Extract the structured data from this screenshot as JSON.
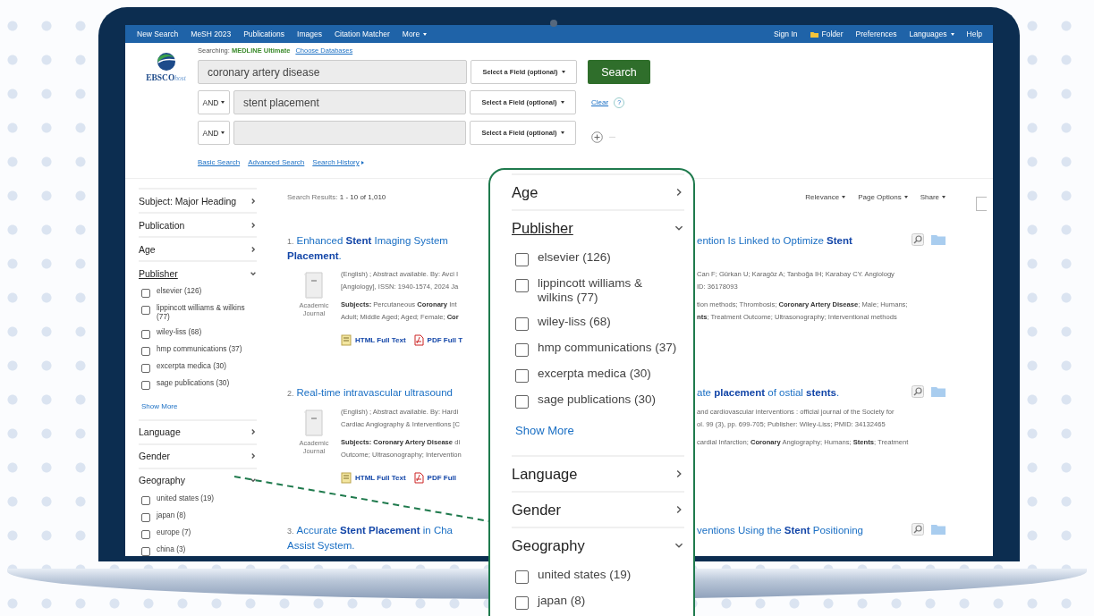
{
  "nav": {
    "left": [
      {
        "label": "New Search",
        "dropdown": false
      },
      {
        "label": "MeSH 2023",
        "dropdown": false
      },
      {
        "label": "Publications",
        "dropdown": false
      },
      {
        "label": "Images",
        "dropdown": false
      },
      {
        "label": "Citation Matcher",
        "dropdown": false
      },
      {
        "label": "More",
        "dropdown": true
      }
    ],
    "right": [
      {
        "label": "Sign In",
        "dropdown": false
      },
      {
        "label": "Folder",
        "dropdown": false,
        "kind": "folder"
      },
      {
        "label": "Preferences",
        "dropdown": false
      },
      {
        "label": "Languages",
        "dropdown": true
      },
      {
        "label": "Help",
        "dropdown": false
      }
    ]
  },
  "logo": {
    "brand": "EBSCO",
    "suffix": "host"
  },
  "search": {
    "searching_label": "Searching:",
    "database": "MEDLINE Ultimate",
    "choose_link": "Choose Databases",
    "rows": [
      {
        "value": "coronary artery disease",
        "field": "Select a Field (optional)"
      },
      {
        "operator": "AND",
        "value": "stent placement",
        "field": "Select a Field (optional)"
      },
      {
        "operator": "AND",
        "field": "Select a Field (optional)"
      }
    ],
    "button": "Search",
    "clear": "Clear",
    "help": "?",
    "links": [
      {
        "label": "Basic Search",
        "submenu": false
      },
      {
        "label": "Advanced Search",
        "submenu": false
      },
      {
        "label": "Search History",
        "submenu": true
      }
    ]
  },
  "sidebar": {
    "facets": [
      {
        "label": "Subject: Major Heading",
        "expanded": false,
        "hovered": false
      },
      {
        "label": "Publication",
        "expanded": false,
        "hovered": false
      },
      {
        "label": "Age",
        "expanded": false,
        "hovered": false
      },
      {
        "label": "Publisher",
        "expanded": true,
        "hovered": true,
        "options": [
          {
            "label": "elsevier (126)",
            "checked": false
          },
          {
            "label": "lippincott williams & wilkins (77)",
            "checked": false
          },
          {
            "label": "wiley-liss (68)",
            "checked": false
          },
          {
            "label": "hmp communications (37)",
            "checked": false
          },
          {
            "label": "excerpta medica (30)",
            "checked": false
          },
          {
            "label": "sage publications (30)",
            "checked": false
          }
        ],
        "show_more": "Show More"
      },
      {
        "label": "Language",
        "expanded": false,
        "hovered": false
      },
      {
        "label": "Gender",
        "expanded": false,
        "hovered": false
      },
      {
        "label": "Geography",
        "expanded": true,
        "hovered": false,
        "options": [
          {
            "label": "united states (19)",
            "checked": false
          },
          {
            "label": "japan (8)",
            "checked": false
          },
          {
            "label": "europe (7)",
            "checked": false
          },
          {
            "label": "china (3)",
            "checked": false
          }
        ]
      }
    ]
  },
  "results": {
    "label": "Search Results:",
    "range": "1 - 10 of 1,010",
    "controls": [
      "Relevance",
      "Page Options",
      "Share"
    ],
    "items": [
      {
        "number": "1.",
        "title_left": [
          "Enhanced **Stent** Imaging System",
          "**Placement**."
        ],
        "title_right": "ention Is Linked to Optimize **Stent**",
        "type": "Academic Journal",
        "meta_left": [
          "(English) ; Abstract available. By: Avci I",
          "[Angiology], ISSN: 1940-1574, 2024 Ja"
        ],
        "meta_right": [
          "Can F; Gürkan U; Karagöz A; Tanboğa IH; Karabay CY. Angiology",
          "ID: 36178093"
        ],
        "subjects_left": [
          "**Subjects:** Percutaneous **Coronary** Int",
          "Adult; Middle Aged; Aged; Female; **Cor**"
        ],
        "subjects_right": [
          "tion methods; Thrombosis; **Coronary Artery Disease**; Male; Humans;",
          "**nts**; Treatment Outcome; Ultrasonography; Interventional methods"
        ],
        "links": [
          "HTML Full Text",
          "PDF Full T"
        ]
      },
      {
        "number": "2.",
        "title_left": [
          "Real-time intravascular ultrasound"
        ],
        "title_right": "ate **placement** of ostial **stents**.",
        "type": "Academic Journal",
        "meta_left": [
          "(English) ; Abstract available. By: Hardi",
          "Cardiac Angiography & Interventions [C"
        ],
        "meta_right": [
          "and cardiovascular interventions : official journal of the Society for",
          "ol. 99 (3), pp. 699-705; Publisher: Wiley-Liss; PMID: 34132465"
        ],
        "subjects_left": [
          "**Subjects: Coronary Artery Disease** di",
          "Outcome; Ultrasonography; Intervention"
        ],
        "subjects_right": [
          "cardial Infarction; **Coronary** Angiography; Humans; **Stents**; Treatment"
        ],
        "links": [
          "HTML Full Text",
          "PDF Full"
        ]
      },
      {
        "number": "3.",
        "title_left": [
          "Accurate **Stent Placement** in Cha",
          "Assist System."
        ],
        "title_right": "ventions Using the **Stent** Positioning"
      }
    ]
  },
  "callout": {
    "facets": [
      {
        "label": "Age",
        "expanded": false,
        "hovered": false
      },
      {
        "label": "Publisher",
        "expanded": true,
        "hovered": true,
        "options": [
          {
            "label": "elsevier (126)",
            "checked": false
          },
          {
            "label": "lippincott williams & wilkins (77)",
            "checked": false
          },
          {
            "label": "wiley-liss (68)",
            "checked": false
          },
          {
            "label": "hmp communications (37)",
            "checked": false
          },
          {
            "label": "excerpta medica (30)",
            "checked": false
          },
          {
            "label": "sage publications (30)",
            "checked": false
          }
        ],
        "show_more": "Show More"
      },
      {
        "label": "Language",
        "expanded": false,
        "hovered": false
      },
      {
        "label": "Gender",
        "expanded": false,
        "hovered": false
      },
      {
        "label": "Geography",
        "expanded": true,
        "hovered": false,
        "options": [
          {
            "label": "united states (19)",
            "checked": false
          },
          {
            "label": "japan (8)",
            "checked": false
          }
        ]
      }
    ]
  }
}
